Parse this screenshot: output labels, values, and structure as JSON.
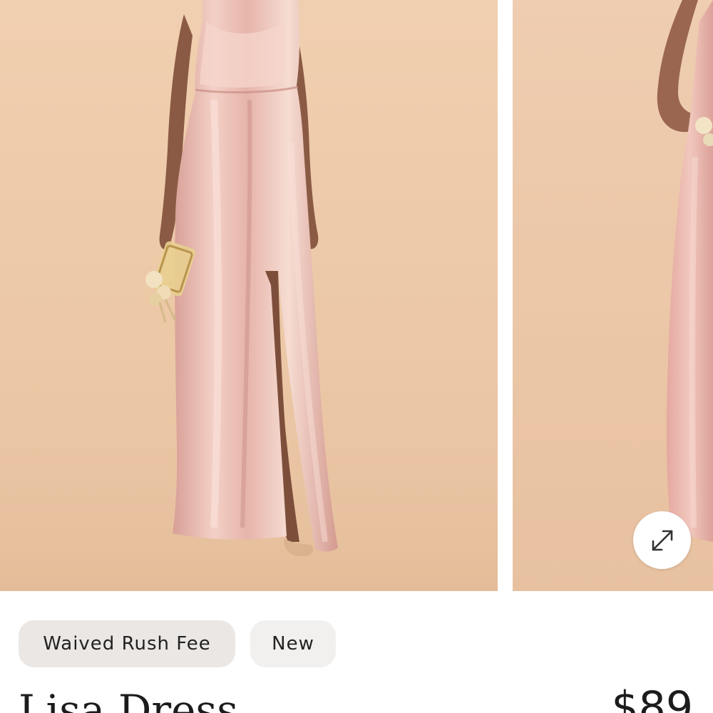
{
  "gallery": {
    "images": [
      {
        "alt": "model-front-view"
      },
      {
        "alt": "model-side-view"
      }
    ],
    "expand_icon": "expand-arrows-icon"
  },
  "badges": {
    "rush": "Waived Rush Fee",
    "new": "New"
  },
  "product": {
    "name": "Lisa Dress",
    "price": "$89"
  },
  "colors": {
    "backdrop": "#ecc8a6",
    "dress": "#e9b8ad",
    "badge_bg": "#ebe7e4",
    "text": "#1c1c1c"
  }
}
